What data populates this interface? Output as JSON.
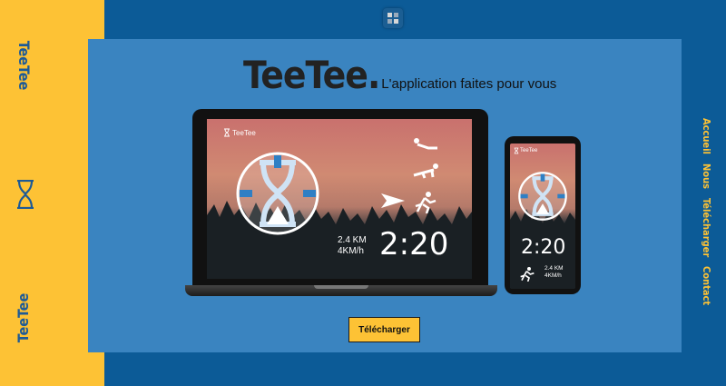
{
  "sidebar": {
    "brand_top": "TeeTee",
    "brand_bottom": "TeeTee",
    "icon": "hourglass-icon"
  },
  "header": {
    "logo": "TeeTee.",
    "tagline": "L'application faites pour vous"
  },
  "nav": {
    "items": [
      "Accueil",
      "Nous",
      "Télécharger",
      "Contact"
    ]
  },
  "laptop_screen": {
    "brand": "TeeTee",
    "time": "2:20",
    "distance": "2.4 KM",
    "speed": "4KM/h"
  },
  "phone_screen": {
    "brand": "TeeTee",
    "time": "2:20",
    "distance": "2.4 KM",
    "speed": "4KM/h"
  },
  "cta": {
    "download_label": "Télécharger"
  },
  "colors": {
    "yellow": "#fdc235",
    "blue_dark": "#0c5b97",
    "blue_card": "#3a84c0"
  }
}
